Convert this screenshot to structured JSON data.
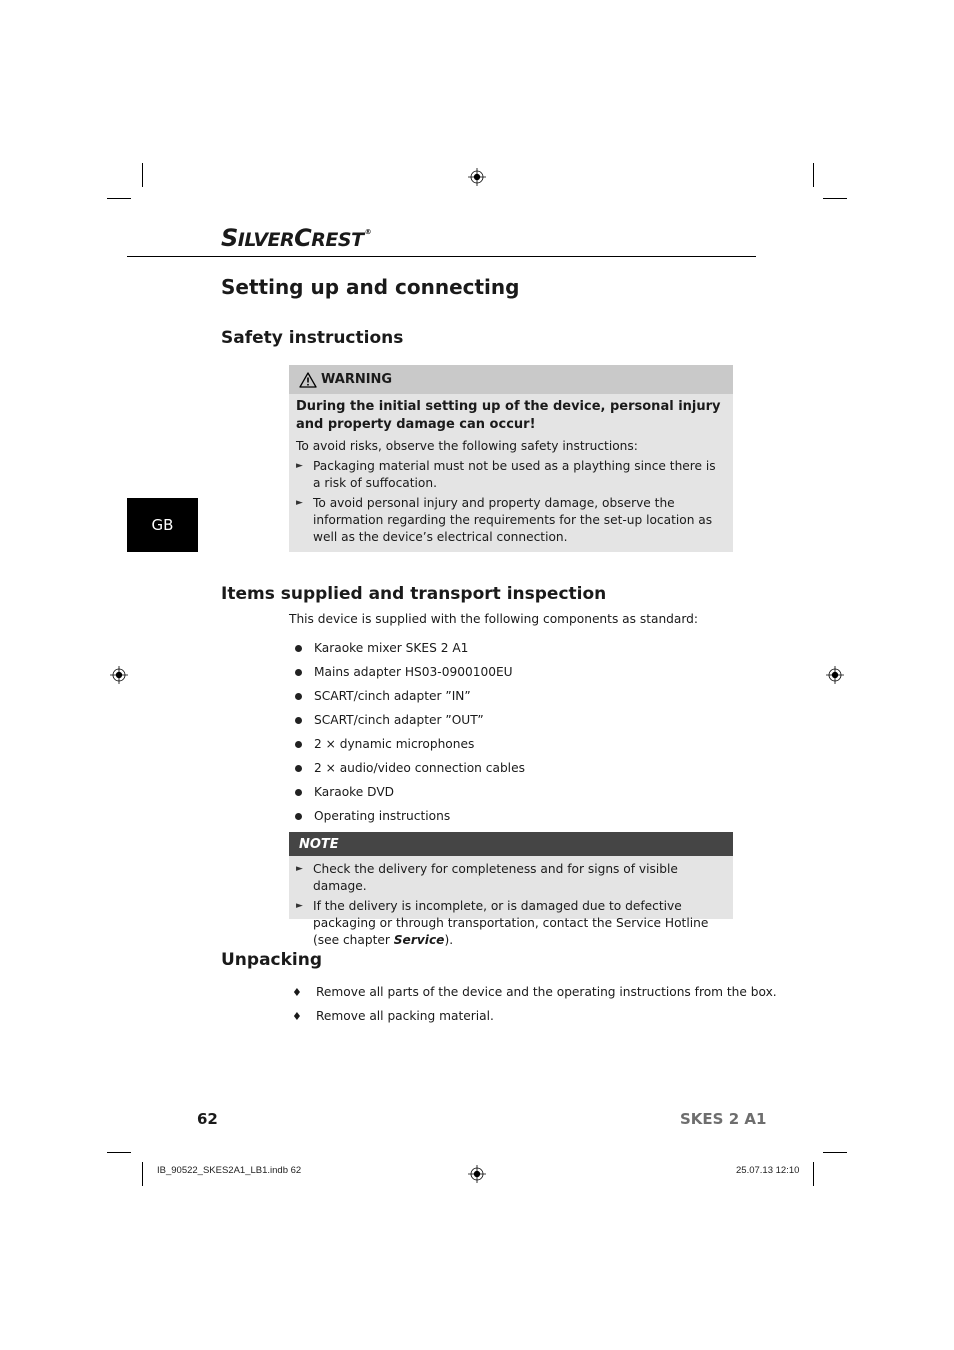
{
  "brand": {
    "logo_text_prefix_big": "S",
    "logo_text_part1": "ILVER",
    "logo_text_prefix_big2": "C",
    "logo_text_part2": "REST",
    "registered_mark": "®"
  },
  "page": {
    "title": "Setting up and connecting",
    "language_tab": "GB",
    "page_number": "62",
    "model": "SKES 2 A1"
  },
  "safety": {
    "heading": "Safety instructions",
    "warning": {
      "icon": "warning-triangle-icon",
      "label": "WARNING",
      "lead": "During the initial setting up of the device, personal injury and property damage can occur!",
      "intro": "To avoid risks, observe the following safety instructions:",
      "items": [
        "Packaging material must not be used as a plaything since there is a risk of suffocation.",
        "To avoid personal injury and property damage, observe the information regarding the requirements for the set-up location as well as the device’s electrical connection."
      ]
    }
  },
  "items_supplied": {
    "heading": "Items supplied and transport inspection",
    "intro": "This device is supplied with the following components as standard:",
    "items": [
      "Karaoke mixer SKES 2 A1",
      "Mains adapter HS03-0900100EU",
      "SCART/cinch adapter ”IN”",
      "SCART/cinch adapter ”OUT”",
      "2 × dynamic microphones",
      "2 × audio/video connection cables",
      "Karaoke DVD",
      "Operating instructions"
    ],
    "note": {
      "label": "NOTE",
      "item1": "Check the delivery for completeness and for signs of visible damage.",
      "item2_prefix": "If the delivery is incomplete, or is damaged due to defective packaging or through transportation, contact the Service Hotline (see chapter ",
      "item2_link": "Service",
      "item2_suffix": ")."
    }
  },
  "unpacking": {
    "heading": "Unpacking",
    "items": [
      "Remove all parts of the device and the operating instructions from the box.",
      "Remove all packing material."
    ]
  },
  "print_slug": {
    "file": "IB_90522_SKES2A1_LB1.indb   62",
    "date_time": "25.07.13   12:10"
  }
}
